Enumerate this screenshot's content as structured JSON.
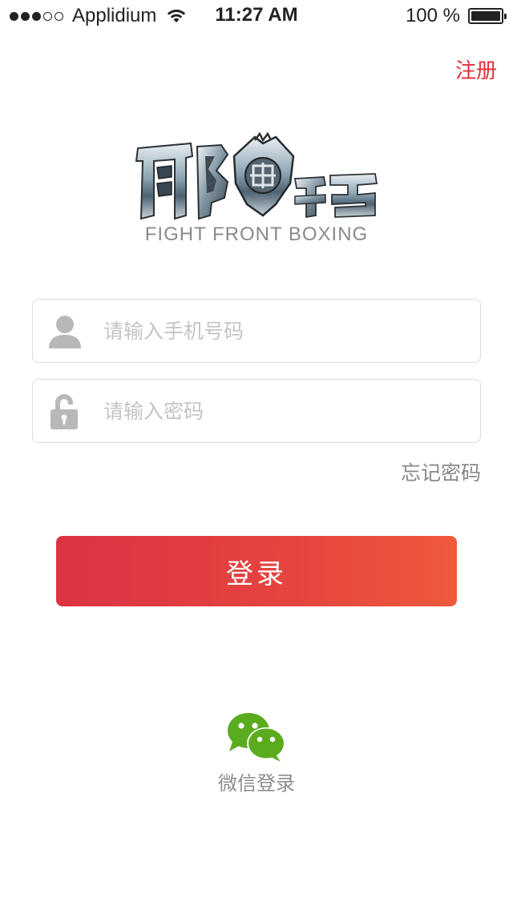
{
  "status_bar": {
    "carrier": "Applidium",
    "time": "11:27 AM",
    "battery": "100 %",
    "signal_bars_filled": 3,
    "signal_bars_total": 5
  },
  "header": {
    "register_label": "注册"
  },
  "logo": {
    "subtitle": "FIGHT FRONT BOXING"
  },
  "form": {
    "phone_placeholder": "请输入手机号码",
    "password_placeholder": "请输入密码",
    "forgot_label": "忘记密码",
    "login_label": "登录"
  },
  "social": {
    "wechat_label": "微信登录"
  },
  "colors": {
    "accent": "#e0303a",
    "button_start": "#dc3344",
    "button_end": "#ee5a3c",
    "wechat_green": "#5aac1e"
  },
  "icons": {
    "wifi": "wifi-icon",
    "battery": "battery-icon",
    "user": "user-icon",
    "lock": "unlocked-padlock-icon",
    "wechat": "wechat-icon"
  }
}
